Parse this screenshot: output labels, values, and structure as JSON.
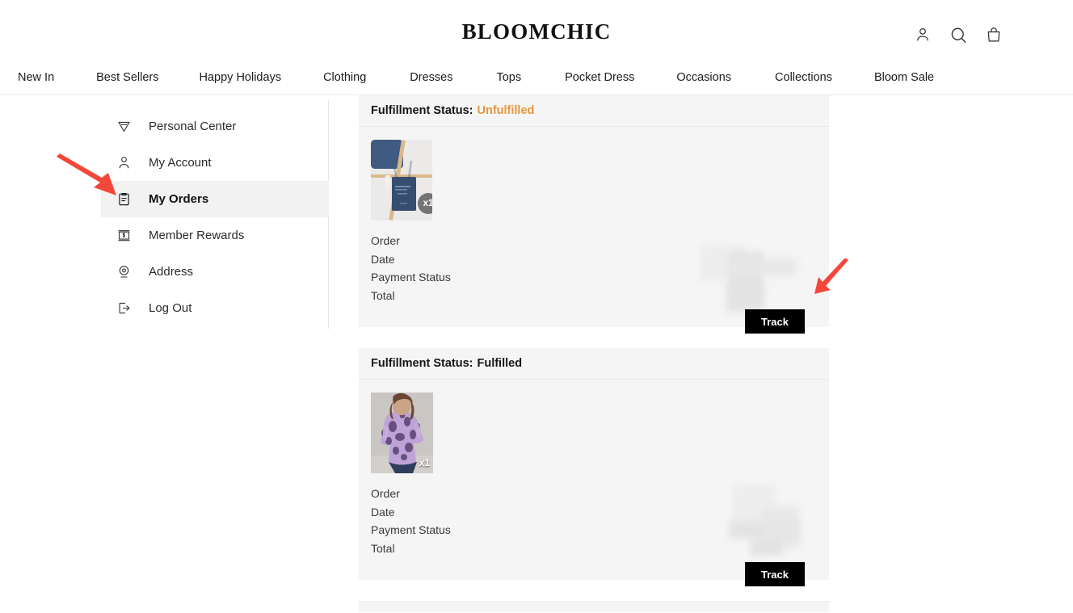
{
  "header": {
    "brand": "BLOOMCHIC",
    "icons": [
      {
        "name": "account-icon",
        "label": "Account"
      },
      {
        "name": "search-icon",
        "label": "Search"
      },
      {
        "name": "cart-bag-icon",
        "label": "Cart"
      }
    ]
  },
  "nav": {
    "items": [
      {
        "label": "New In"
      },
      {
        "label": "Best Sellers"
      },
      {
        "label": "Happy Holidays"
      },
      {
        "label": "Clothing"
      },
      {
        "label": "Dresses"
      },
      {
        "label": "Tops"
      },
      {
        "label": "Pocket Dress"
      },
      {
        "label": "Occasions"
      },
      {
        "label": "Collections"
      },
      {
        "label": "Bloom Sale"
      }
    ]
  },
  "sidebar": {
    "items": [
      {
        "label": "Personal Center",
        "icon": "shield-down-icon",
        "active": false
      },
      {
        "label": "My Account",
        "icon": "user-icon",
        "active": false
      },
      {
        "label": "My Orders",
        "icon": "clipboard-icon",
        "active": true
      },
      {
        "label": "Member Rewards",
        "icon": "coupon-icon",
        "active": false
      },
      {
        "label": "Address",
        "icon": "location-pin-icon",
        "active": false
      },
      {
        "label": "Log Out",
        "icon": "logout-icon",
        "active": false
      }
    ]
  },
  "orders": {
    "status_label": "Fulfillment Status:",
    "meta_labels": [
      "Order",
      "Date",
      "Payment Status",
      "Total"
    ],
    "track_label": "Track",
    "cards": [
      {
        "status": "Unfulfilled",
        "status_tone": "unfulfilled",
        "quantity_badge": "x1",
        "product_alt": "Navy denim tote bag on wooden rack",
        "order": "",
        "date": "",
        "payment_status": "",
        "total": ""
      },
      {
        "status": "Fulfilled",
        "status_tone": "fulfilled",
        "quantity_badge": "x1",
        "product_alt": "Model wearing lavender floral print top with jeans",
        "order": "",
        "date": "",
        "payment_status": "",
        "total": ""
      }
    ]
  },
  "annotations": {
    "arrow_color": "#f4473b",
    "arrows": [
      {
        "name": "arrow-pointing-to-my-orders",
        "target": "My Orders"
      },
      {
        "name": "arrow-pointing-to-track-button",
        "target": "Track"
      }
    ]
  },
  "colors": {
    "accent_unfulfilled": "#e8963c",
    "card_background": "#f5f5f5",
    "button_background": "#000000",
    "active_sidebar_background": "#f2f2f2",
    "annotation_red": "#f4473b"
  }
}
